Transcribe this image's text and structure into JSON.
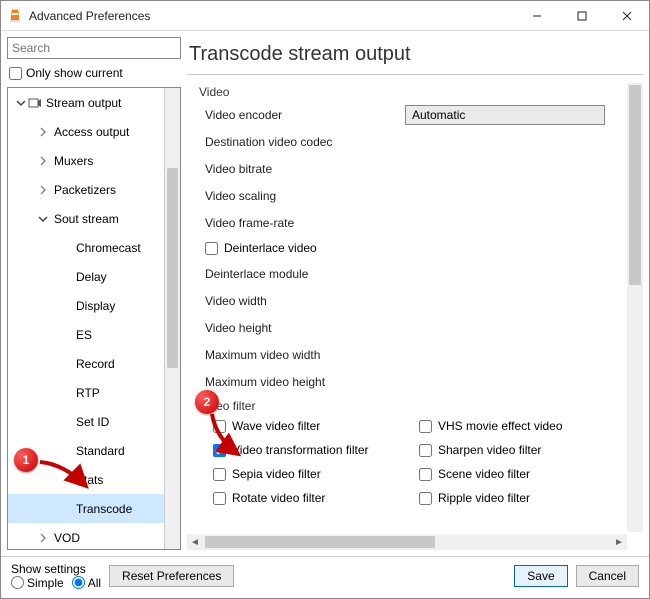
{
  "window": {
    "title": "Advanced Preferences"
  },
  "left": {
    "search_placeholder": "Search",
    "only_current": "Only show current",
    "tree": [
      {
        "label": "Stream output",
        "depth": 0,
        "expander": "down",
        "icon": true
      },
      {
        "label": "Access output",
        "depth": 1,
        "expander": "right"
      },
      {
        "label": "Muxers",
        "depth": 1,
        "expander": "right"
      },
      {
        "label": "Packetizers",
        "depth": 1,
        "expander": "right"
      },
      {
        "label": "Sout stream",
        "depth": 1,
        "expander": "down"
      },
      {
        "label": "Chromecast",
        "depth": 2
      },
      {
        "label": "Delay",
        "depth": 2
      },
      {
        "label": "Display",
        "depth": 2
      },
      {
        "label": "ES",
        "depth": 2
      },
      {
        "label": "Record",
        "depth": 2
      },
      {
        "label": "RTP",
        "depth": 2
      },
      {
        "label": "Set ID",
        "depth": 2
      },
      {
        "label": "Standard",
        "depth": 2
      },
      {
        "label": "Stats",
        "depth": 2
      },
      {
        "label": "Transcode",
        "depth": 2,
        "selected": true
      },
      {
        "label": "VOD",
        "depth": 1,
        "expander": "right"
      }
    ]
  },
  "right": {
    "heading": "Transcode stream output",
    "group_video": "Video",
    "rows": {
      "video_encoder_label": "Video encoder",
      "video_encoder_value": "Automatic",
      "dest_codec": "Destination video codec",
      "bitrate": "Video bitrate",
      "scaling": "Video scaling",
      "framerate": "Video frame-rate",
      "deinterlace": "Deinterlace video",
      "deint_module": "Deinterlace module",
      "width": "Video width",
      "height": "Video height",
      "max_width": "Maximum video width",
      "max_height": "Maximum video height"
    },
    "group_filter": "Video filter",
    "filters_left": [
      {
        "label": "Wave video filter",
        "checked": false
      },
      {
        "label": "Video transformation filter",
        "checked": true
      },
      {
        "label": "Sepia video filter",
        "checked": false
      },
      {
        "label": "Rotate video filter",
        "checked": false
      }
    ],
    "filters_right": [
      {
        "label": "VHS movie effect video",
        "checked": false
      },
      {
        "label": "Sharpen video filter",
        "checked": false
      },
      {
        "label": "Scene video filter",
        "checked": false
      },
      {
        "label": "Ripple video filter",
        "checked": false
      }
    ]
  },
  "bottom": {
    "show_settings": "Show settings",
    "simple": "Simple",
    "all": "All",
    "reset": "Reset Preferences",
    "save": "Save",
    "cancel": "Cancel"
  },
  "callouts": {
    "one": "1",
    "two": "2"
  }
}
